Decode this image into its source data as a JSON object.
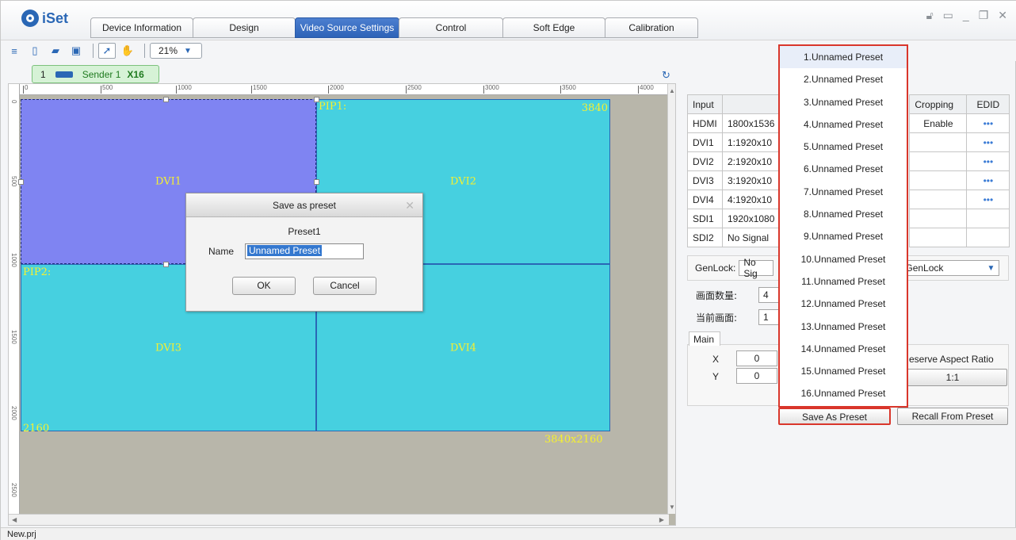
{
  "app": {
    "name": "iSet",
    "status_file": "New.prj"
  },
  "tabs": [
    {
      "label": "Device Information",
      "active": false
    },
    {
      "label": "Design",
      "active": false
    },
    {
      "label": "Video Source Settings",
      "active": true
    },
    {
      "label": "Control",
      "active": false
    },
    {
      "label": "Soft Edge",
      "active": false
    },
    {
      "label": "Calibration",
      "active": false
    }
  ],
  "window_controls": [
    "lock-icon",
    "restore-icon",
    "minimize-icon",
    "maximize-icon",
    "close-icon"
  ],
  "toolbar": {
    "zoom": "21%",
    "icons": [
      "menu-icon",
      "new-file-icon",
      "open-folder-icon",
      "save-icon",
      "select-pointer-icon",
      "pan-hand-icon"
    ]
  },
  "sender": {
    "index": "1",
    "name": "Sender 1",
    "ports": "X16"
  },
  "ruler": {
    "top": [
      "0",
      "500",
      "1000",
      "1500",
      "2000",
      "2500",
      "3000",
      "3500",
      "4000"
    ],
    "left": [
      "0",
      "500",
      "1000",
      "1500",
      "2000",
      "2500"
    ]
  },
  "canvas": {
    "pips": {
      "dvi1": "DVI1",
      "dvi2": "DVI2",
      "dvi3": "DVI3",
      "dvi4": "DVI4"
    },
    "pip1_label": "PIP1:",
    "pip2_label": "PIP2:",
    "width_label": "3840",
    "height_label": "2160",
    "size_label": "3840x2160"
  },
  "dialog": {
    "title": "Save as preset",
    "subtitle": "Preset1",
    "name_label": "Name",
    "name_value": "Unnamed Preset",
    "ok": "OK",
    "cancel": "Cancel"
  },
  "inputs_table": {
    "headers": {
      "input": "Input",
      "cropping": "Cropping",
      "edid": "EDID"
    },
    "rows": [
      {
        "input": "HDMI",
        "resolution": "1800x1536",
        "cropping": "Enable",
        "edid": "•••"
      },
      {
        "input": "DVI1",
        "resolution": "1:1920x10",
        "cropping": "",
        "edid": "•••"
      },
      {
        "input": "DVI2",
        "resolution": "2:1920x10",
        "cropping": "",
        "edid": "•••"
      },
      {
        "input": "DVI3",
        "resolution": "3:1920x10",
        "cropping": "",
        "edid": "•••"
      },
      {
        "input": "DVI4",
        "resolution": "4:1920x10",
        "cropping": "",
        "edid": "•••"
      },
      {
        "input": "SDI1",
        "resolution": "1920x1080",
        "cropping": "",
        "edid": ""
      },
      {
        "input": "SDI2",
        "resolution": "No Signal",
        "cropping": "",
        "edid": ""
      }
    ]
  },
  "genlock": {
    "label": "GenLock:",
    "value": "No Sig",
    "select": "GenLock"
  },
  "layout": {
    "count_label": "画面数量:",
    "count_value": "4",
    "current_label": "当前画面:",
    "current_value": "1",
    "tab_main": "Main",
    "x_label": "X",
    "x_value": "0",
    "y_label": "Y",
    "y_value": "0",
    "aspect_label": "eserve Aspect Ratio",
    "aspect_btn": "1:1"
  },
  "presets": [
    "1.Unnamed Preset",
    "2.Unnamed Preset",
    "3.Unnamed Preset",
    "4.Unnamed Preset",
    "5.Unnamed Preset",
    "6.Unnamed Preset",
    "7.Unnamed Preset",
    "8.Unnamed Preset",
    "9.Unnamed Preset",
    "10.Unnamed Preset",
    "11.Unnamed Preset",
    "12.Unnamed Preset",
    "13.Unnamed Preset",
    "14.Unnamed Preset",
    "15.Unnamed Preset",
    "16.Unnamed Preset"
  ],
  "buttons": {
    "save_preset": "Save As Preset",
    "recall_preset": "Recall From Preset"
  }
}
